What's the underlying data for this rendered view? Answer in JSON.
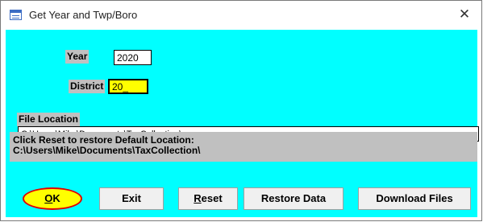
{
  "window": {
    "title": "Get Year and Twp/Boro",
    "close_glyph": "✕",
    "title_icon": "form-icon"
  },
  "form": {
    "year_label": "Year",
    "year_value": "2020",
    "district_label": "District",
    "district_value": "20_",
    "file_location_label": "File Location",
    "file_location_value": "C:\\Users\\Mike\\Documents\\TaxCollection\\",
    "info_line1": "Click Reset to restore Default Location:",
    "info_line2": "C:\\Users\\Mike\\Documents\\TaxCollection\\"
  },
  "buttons": {
    "ok_accel": "O",
    "ok_rest": "K",
    "exit": "Exit",
    "reset_accel": "R",
    "reset_rest": "eset",
    "restore_data": "Restore Data",
    "download_files": "Download Files"
  },
  "colors": {
    "client_background": "#00ffff",
    "label_background": "#c0c0c0",
    "district_field": "#ffff00",
    "ok_highlight_fill": "#ffff00",
    "ok_highlight_ring": "#e00000"
  }
}
